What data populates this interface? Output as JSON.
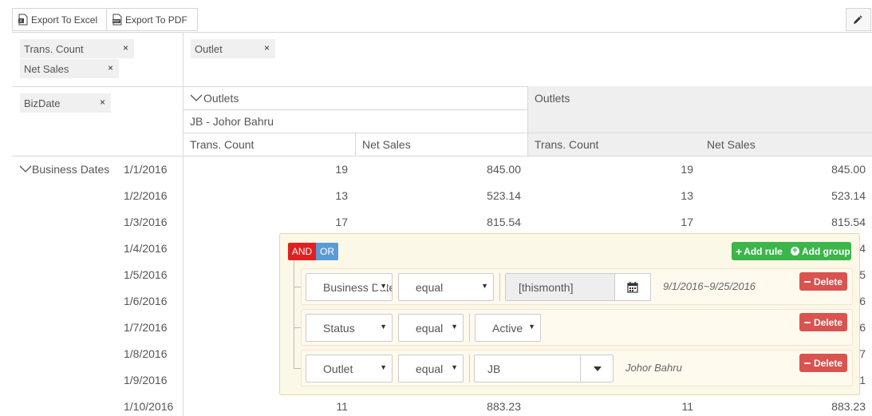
{
  "toolbar": {
    "export_excel": "Export To Excel",
    "export_pdf": "Export To PDF"
  },
  "pivot": {
    "value_fields": [
      {
        "label": "Trans. Count",
        "remove": "×"
      },
      {
        "label": "Net Sales",
        "remove": "×"
      }
    ],
    "column_fields": [
      {
        "label": "Outlet",
        "remove": "×"
      }
    ],
    "row_fields": [
      {
        "label": "BizDate",
        "remove": "×"
      }
    ],
    "outlets_header": "Outlets",
    "outlet_name": "JB - Johor Bahru",
    "total_outlets_header": "Outlets",
    "measure_headers": [
      "Trans. Count",
      "Net Sales",
      "Trans. Count",
      "Net Sales"
    ],
    "row_group_label": "Business Dates",
    "rows": [
      {
        "date": "1/1/2016",
        "count": "19",
        "sales": "845.00",
        "tcount": "19",
        "tsales": "845.00"
      },
      {
        "date": "1/2/2016",
        "count": "13",
        "sales": "523.14",
        "tcount": "13",
        "tsales": "523.14"
      },
      {
        "date": "1/3/2016",
        "count": "17",
        "sales": "815.54",
        "tcount": "17",
        "tsales": "815.54"
      },
      {
        "date": "1/4/2016",
        "tsales": "4"
      },
      {
        "date": "1/5/2016",
        "tsales": "5"
      },
      {
        "date": "1/6/2016",
        "tsales": "6"
      },
      {
        "date": "1/7/2016",
        "tsales": "6"
      },
      {
        "date": "1/8/2016",
        "tsales": "7"
      },
      {
        "date": "1/9/2016",
        "tsales": "1"
      },
      {
        "date": "1/10/2016",
        "count": "11",
        "sales": "883.23",
        "tcount": "11",
        "tsales": "883.23"
      }
    ]
  },
  "query_builder": {
    "and_label": "AND",
    "or_label": "OR",
    "add_rule": "Add rule",
    "add_group": "Add group",
    "delete_label": "Delete",
    "rules": [
      {
        "field": "Business Date",
        "operator": "equal",
        "value": "[thismonth]",
        "hint": "9/1/2016~9/25/2016"
      },
      {
        "field": "Status",
        "operator": "equal",
        "value": "Active"
      },
      {
        "field": "Outlet",
        "operator": "equal",
        "value": "JB",
        "hint": "Johor Bahru"
      }
    ]
  },
  "colors": {
    "and_active": "#e02020",
    "or_inactive": "#5b9bd5",
    "add_green": "#3cb54a",
    "delete_red": "#d9534f"
  }
}
